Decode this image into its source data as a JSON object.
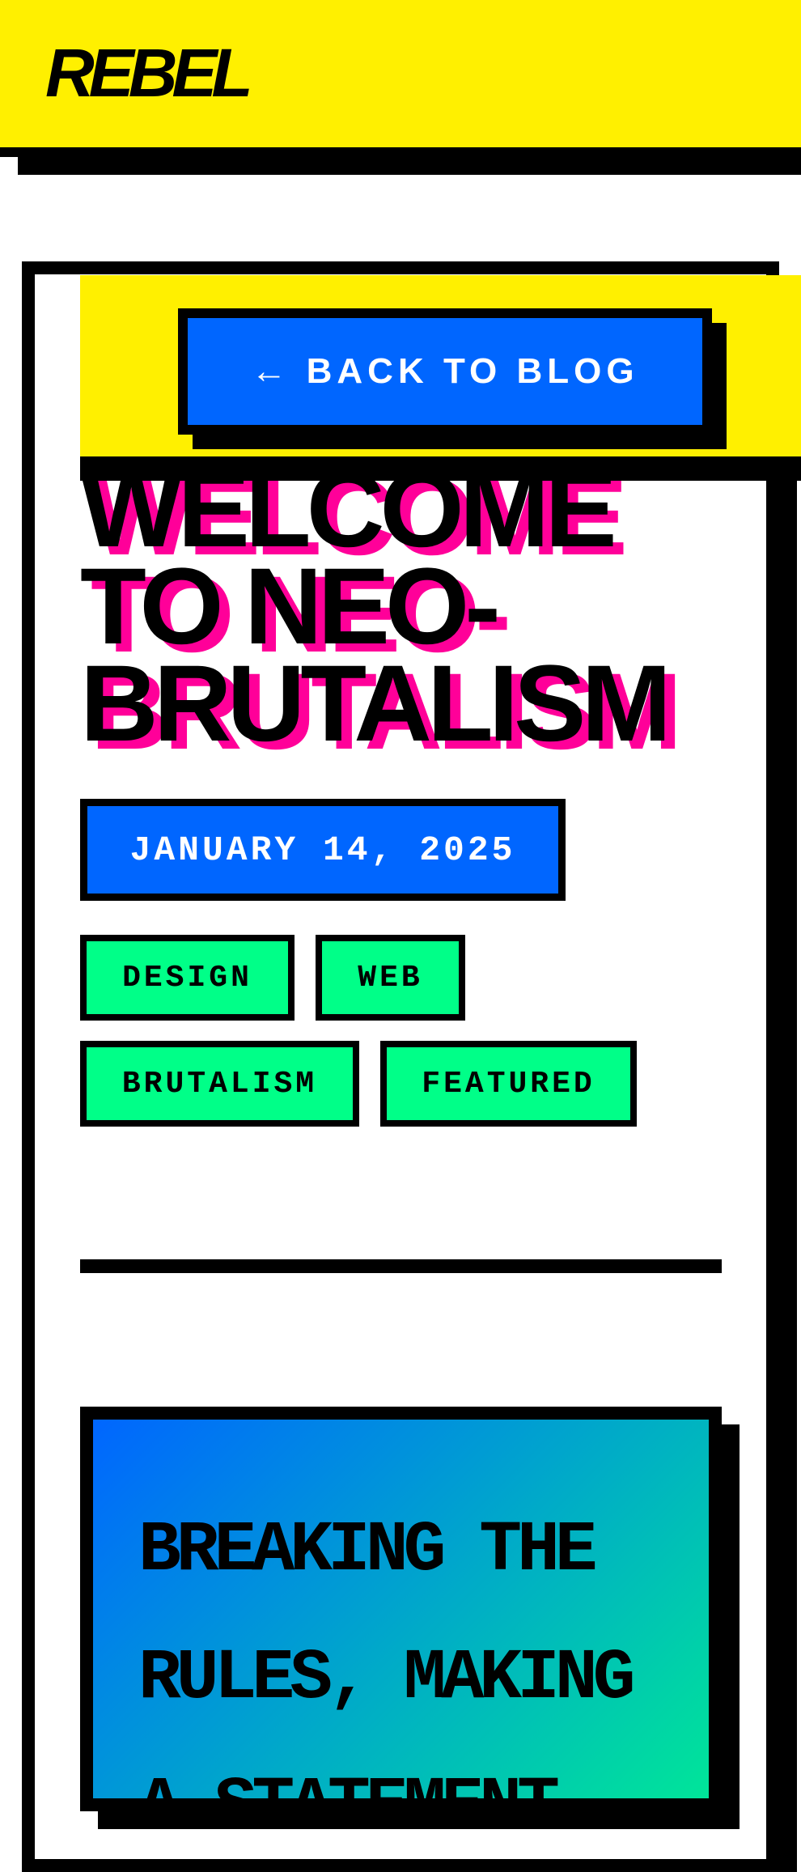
{
  "header": {
    "logo": "REBEL"
  },
  "nav": {
    "back_label": "← BACK TO BLOG"
  },
  "article": {
    "title": "WELCOME TO NEO-BRUTALISM",
    "date": "JANUARY 14, 2025",
    "tags": [
      "DESIGN",
      "WEB",
      "BRUTALISM",
      "FEATURED"
    ],
    "callout": "BREAKING THE RULES, MAKING A STATEMENT"
  },
  "colors": {
    "yellow": "#fff000",
    "blue": "#0066ff",
    "green": "#00ff88",
    "pink": "#ff0099",
    "black": "#000000",
    "white": "#ffffff"
  }
}
